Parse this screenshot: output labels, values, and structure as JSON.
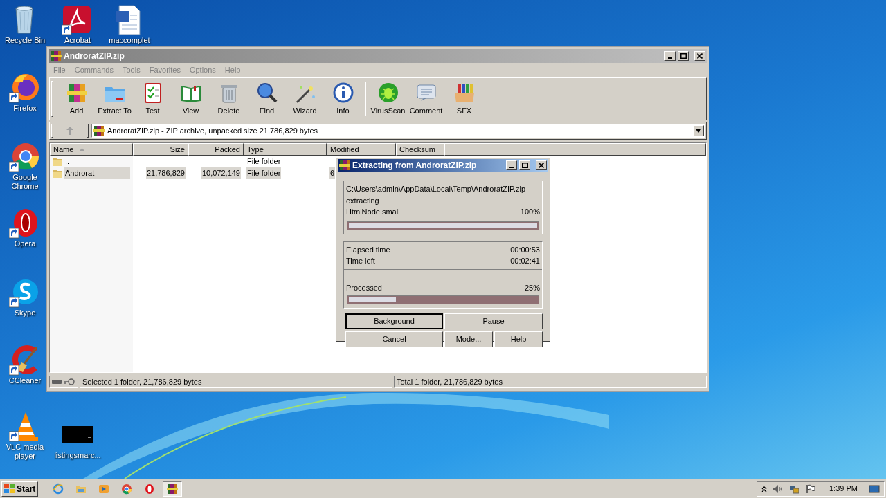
{
  "desktop": {
    "icons": [
      {
        "label": "Recycle Bin"
      },
      {
        "label": "Acrobat"
      },
      {
        "label": "maccomplet"
      },
      {
        "label": "Firefox"
      },
      {
        "label": "Google Chrome"
      },
      {
        "label": "Opera"
      },
      {
        "label": "Skype"
      },
      {
        "label": "CCleaner"
      },
      {
        "label": "VLC media player"
      },
      {
        "label": "listingsmarc..."
      }
    ]
  },
  "window": {
    "title": "AndroratZIP.zip",
    "menu": [
      "File",
      "Commands",
      "Tools",
      "Favorites",
      "Options",
      "Help"
    ],
    "toolbar": {
      "groups": [
        [
          {
            "label": "Add"
          },
          {
            "label": "Extract To"
          },
          {
            "label": "Test"
          },
          {
            "label": "View"
          },
          {
            "label": "Delete"
          },
          {
            "label": "Find"
          },
          {
            "label": "Wizard"
          },
          {
            "label": "Info"
          }
        ],
        [
          {
            "label": "VirusScan"
          },
          {
            "label": "Comment"
          },
          {
            "label": "SFX"
          }
        ]
      ]
    },
    "address": "AndroratZIP.zip - ZIP archive, unpacked size 21,786,829 bytes",
    "table": {
      "columns": [
        "Name",
        "Size",
        "Packed",
        "Type",
        "Modified",
        "Checksum"
      ],
      "rows": [
        {
          "name": "..",
          "type": "File folder",
          "selected": false
        },
        {
          "name": "Androrat",
          "size": "21,786,829",
          "packed": "10,072,149",
          "type": "File folder",
          "modified": "6",
          "selected": true
        }
      ]
    },
    "status_bar": [
      "Selected 1 folder, 21,786,829 bytes",
      "Total 1 folder, 21,786,829 bytes"
    ]
  },
  "dialog": {
    "title": "Extracting from AndroratZIP.zip",
    "path": "C:\\Users\\admin\\AppData\\Local\\Temp\\AndroratZIP.zip",
    "action": "extracting",
    "file": "HtmlNode.smali",
    "file_percent": "100%",
    "file_progress": {
      "level": 1
    },
    "times": [
      {
        "label": "Elapsed time",
        "value": "00:00:53"
      },
      {
        "label": "Time left",
        "value": "00:02:41"
      }
    ],
    "processed": {
      "label": "Processed",
      "percent": "25%",
      "level": 0.25
    },
    "buttons": [
      {
        "label": "Background",
        "default": true
      },
      {
        "label": "Pause",
        "default": false
      },
      {
        "label": "Cancel",
        "default": false
      },
      {
        "label": "Mode...",
        "default": false
      },
      {
        "label": "Help",
        "default": false
      }
    ]
  },
  "taskbar": {
    "start": "Start",
    "apps": [
      {
        "selected": false
      },
      {
        "selected": false
      },
      {
        "selected": false
      },
      {
        "selected": false
      },
      {
        "selected": false
      },
      {
        "selected": true
      }
    ],
    "clock": "1:39 PM"
  }
}
